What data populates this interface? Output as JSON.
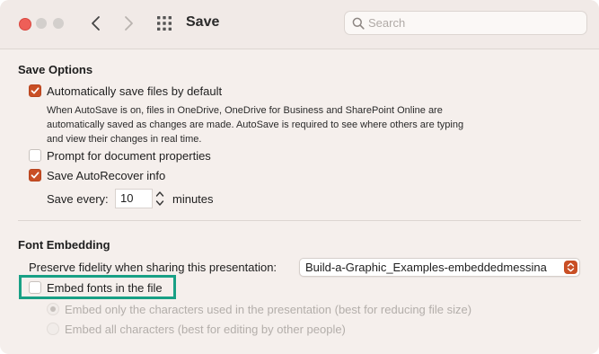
{
  "window": {
    "title": "Save",
    "search_placeholder": "Search"
  },
  "icons": {
    "back": "chevron-left-icon",
    "forward": "chevron-right-icon",
    "grid": "grid-icon",
    "search": "search-icon"
  },
  "save_options": {
    "heading": "Save Options",
    "autosave_label": "Automatically save files by default",
    "autosave_checked": true,
    "autosave_desc": "When AutoSave is on, files in OneDrive, OneDrive for Business and SharePoint Online are automatically saved as changes are made. AutoSave is required to see where others are typing and view their changes in real time.",
    "prompt_label": "Prompt for document properties",
    "prompt_checked": false,
    "autorecover_label": "Save AutoRecover info",
    "autorecover_checked": true,
    "save_every_label": "Save every:",
    "save_every_value": "10",
    "minutes_label": "minutes"
  },
  "font_embedding": {
    "heading": "Font Embedding",
    "preserve_label": "Preserve fidelity when sharing this presentation:",
    "presentation_selected": "Build-a-Graphic_Examples-embeddedmessina",
    "embed_fonts_label": "Embed fonts in the file",
    "embed_fonts_checked": false,
    "embed_only_label": "Embed only the characters used in the presentation (best for reducing file size)",
    "embed_all_label": "Embed all characters (best for editing by other people)"
  },
  "colors": {
    "accent": "#c94f25",
    "highlight": "#18a085"
  }
}
